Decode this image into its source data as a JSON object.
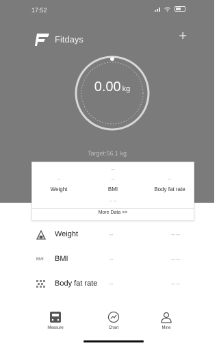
{
  "status": {
    "time": "17:52"
  },
  "header": {
    "app_name": "Fitdays",
    "plus_label": "+"
  },
  "gauge": {
    "value": "0.00",
    "unit": "kg"
  },
  "target": "Target:56.1 kg",
  "card": {
    "weight": {
      "value": "--",
      "label": "Weight"
    },
    "bmi": {
      "top": "--",
      "value": "--",
      "bottom": "-- --",
      "label": "BMI"
    },
    "bodyfat": {
      "value": "--",
      "label": "Body fat rate"
    },
    "more": "More Data >>"
  },
  "rows": [
    {
      "label": "Weight",
      "mid": "--",
      "right": "-- --",
      "icon": "weight-scale-icon"
    },
    {
      "label": "BMI",
      "mid": "--",
      "right": "-- --",
      "icon": "bmi-icon",
      "icon_text": "BMI"
    },
    {
      "label": "Body fat rate",
      "mid": "--",
      "right": "-- --",
      "icon": "body-fat-icon"
    }
  ],
  "tabs": [
    {
      "label": "Measure",
      "icon": "scale-icon"
    },
    {
      "label": "Chart",
      "icon": "chart-icon"
    },
    {
      "label": "Mine",
      "icon": "user-icon"
    }
  ]
}
